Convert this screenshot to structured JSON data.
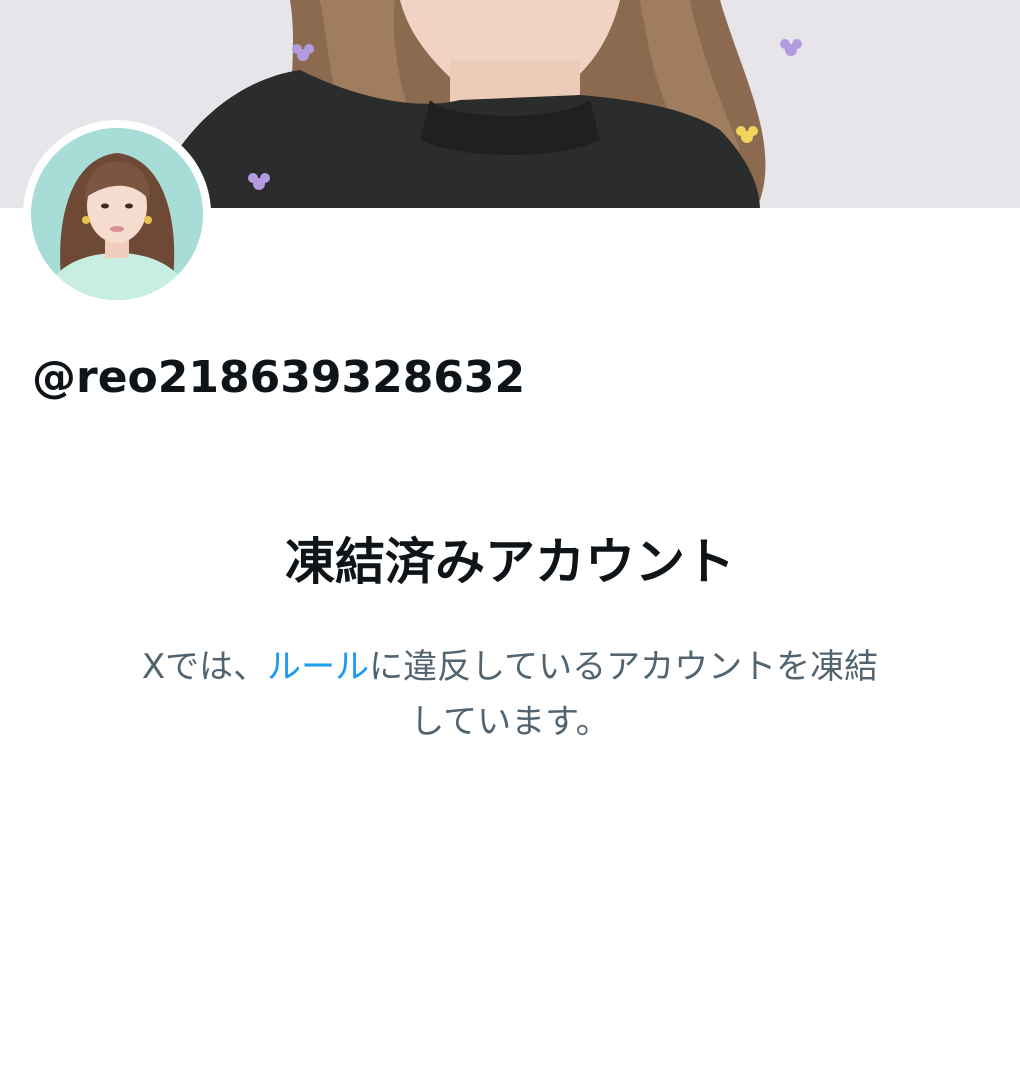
{
  "profile": {
    "handle": "@reo218639328632"
  },
  "suspension": {
    "title": "凍結済みアカウント",
    "message_prefix": "Xでは、",
    "rules_link": "ルール",
    "message_middle": "に違反しているアカウントを凍結",
    "message_suffix": "しています。"
  },
  "colors": {
    "link": "#1d9bf0",
    "primary_text": "#0f1419",
    "secondary_text": "#536471"
  }
}
